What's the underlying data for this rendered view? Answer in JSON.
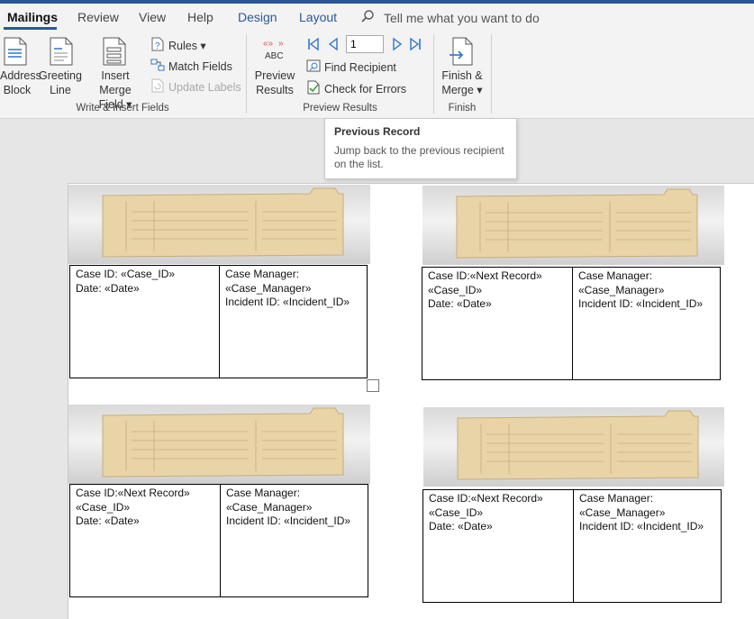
{
  "tabs": {
    "mailings": "Mailings",
    "review": "Review",
    "view": "View",
    "help": "Help",
    "design": "Design",
    "layout": "Layout",
    "tell_me": "Tell me what you want to do"
  },
  "ribbon": {
    "write_insert": {
      "address_block": [
        "Address",
        "Block"
      ],
      "greeting_line": [
        "Greeting",
        "Line"
      ],
      "insert_merge_field": [
        "Insert Merge",
        "Field ▾"
      ],
      "rules": "Rules ▾",
      "match_fields": "Match Fields",
      "update_labels": "Update Labels",
      "group_label": "Write & Insert Fields"
    },
    "preview": {
      "preview_results": [
        "Preview",
        "Results"
      ],
      "abc_icon_text": "ABC",
      "record_value": "1",
      "find_recipient": "Find Recipient",
      "check_for_errors": "Check for Errors",
      "group_label": "Preview Results"
    },
    "finish": {
      "finish_merge": [
        "Finish &",
        "Merge ▾"
      ],
      "group_label": "Finish"
    }
  },
  "tooltip": {
    "title": "Previous Record",
    "body_line1": "Jump back to the previous recipient",
    "body_line2": "on the list."
  },
  "labels": [
    {
      "left": [
        "Case ID: «Case_ID»",
        "Date: «Date»"
      ],
      "right": [
        "Case Manager:",
        "«Case_Manager»",
        "Incident ID: «Incident_ID»"
      ]
    },
    {
      "left": [
        "Case ID:«Next Record»",
        "«Case_ID»",
        "Date: «Date»"
      ],
      "right": [
        "Case Manager:",
        "«Case_Manager»",
        "Incident ID: «Incident_ID»"
      ]
    },
    {
      "left": [
        "Case ID:«Next Record»",
        "«Case_ID»",
        "Date: «Date»"
      ],
      "right": [
        "Case Manager:",
        "«Case_Manager»",
        "Incident ID: «Incident_ID»"
      ]
    },
    {
      "left": [
        "Case ID:«Next Record»",
        "«Case_ID»",
        "Date: «Date»"
      ],
      "right": [
        "Case Manager:",
        "«Case_Manager»",
        "Incident ID: «Incident_ID»"
      ]
    }
  ],
  "colors": {
    "accent": "#2b579a",
    "folder_tan": "#e9d4a8",
    "nav_blue": "#2e75c8",
    "preview_red": "#d9534f"
  }
}
